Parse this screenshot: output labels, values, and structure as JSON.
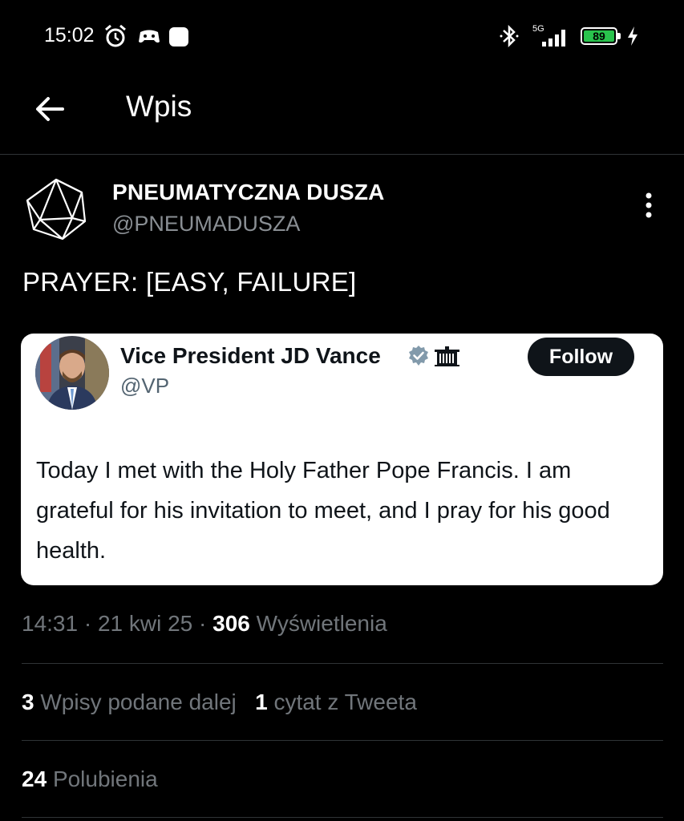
{
  "status_bar": {
    "time": "15:02",
    "network": "5G",
    "battery": "89"
  },
  "header": {
    "title": "Wpis"
  },
  "post": {
    "author_name": "PNEUMATYCZNA DUSZA",
    "author_handle": "@PNEUMADUSZA",
    "text": "PRAYER: [EASY, FAILURE]",
    "time": "14:31",
    "date": "21 kwi 25",
    "views_count": "306",
    "views_label": "Wyświetlenia",
    "sep": "·"
  },
  "embedded_tweet": {
    "name": "Vice President JD Vance",
    "handle": "@VP",
    "follow_label": "Follow",
    "text": "Today I met with the Holy Father Pope Francis. I am grateful for his invitation to meet, and I pray for his good health."
  },
  "stats": {
    "reposts_count": "3",
    "reposts_label": "Wpisy podane dalej",
    "quotes_count": "1",
    "quotes_label": "cytat z Tweeta",
    "likes_count": "24",
    "likes_label": "Polubienia"
  },
  "icons": {
    "back": "arrow-left-icon",
    "more": "more-vertical-icon",
    "verified": "verified-badge-icon",
    "white_house": "white-house-icon"
  },
  "colors": {
    "background": "#000000",
    "secondary_text": "#71767b",
    "verified_badge": "#829aab",
    "follow_button": "#0f1419"
  }
}
